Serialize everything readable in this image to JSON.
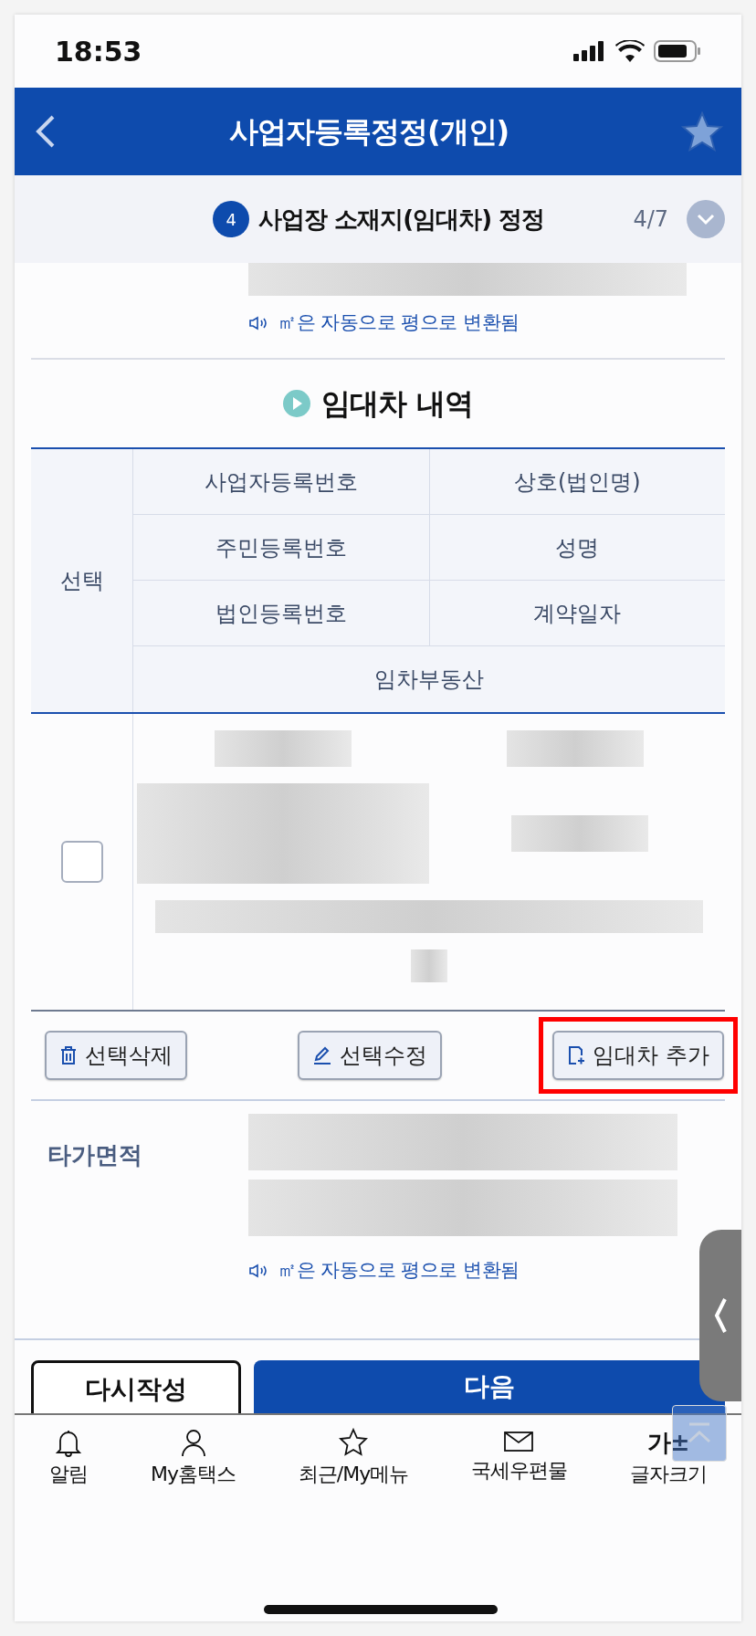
{
  "status_bar": {
    "time": "18:53"
  },
  "header": {
    "title": "사업자등록정정(개인)"
  },
  "step": {
    "number": "4",
    "title": "사업장 소재지(임대차) 정정",
    "progress": "4/7",
    "expanded": false
  },
  "area_note_top": "㎡은 자동으로 평으로 변환됨",
  "lease_section": {
    "title": "임대차 내역",
    "select_header": "선택",
    "header_rows": [
      [
        "사업자등록번호",
        "상호(법인명)"
      ],
      [
        "주민등록번호",
        "성명"
      ],
      [
        "법인등록번호",
        "계약일자"
      ],
      [
        "임차부동산"
      ]
    ],
    "rows": [
      {
        "checked": false
      }
    ]
  },
  "actions": [
    {
      "label": "선택삭제",
      "kind": "delete",
      "highlighted": false
    },
    {
      "label": "선택수정",
      "kind": "edit",
      "highlighted": false
    },
    {
      "label": "임대차 추가",
      "kind": "add",
      "highlighted": true
    }
  ],
  "other_area": {
    "label": "타가면적",
    "note": "㎡은 자동으로 평으로 변환됨"
  },
  "footer_buttons": [
    {
      "label": "다시작성",
      "kind": "secondary"
    },
    {
      "label": "다음",
      "kind": "primary"
    }
  ],
  "tab_bar": [
    {
      "label": "알림",
      "kind": "bell"
    },
    {
      "label": "My홈택스",
      "kind": "user"
    },
    {
      "label": "최근/My메뉴",
      "kind": "star"
    },
    {
      "label": "국세우편물",
      "kind": "mail"
    },
    {
      "label": "글자크기",
      "kind": "text",
      "glyph": "가±"
    }
  ]
}
